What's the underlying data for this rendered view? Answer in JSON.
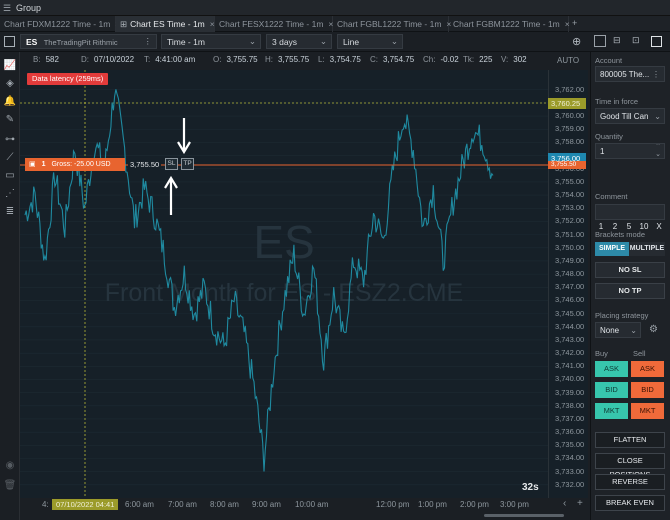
{
  "window": {
    "title": "Group"
  },
  "tabs": [
    {
      "label": "Chart FDXM1222 Time - 1m",
      "active": false
    },
    {
      "label": "Chart ES Time - 1m",
      "active": true
    },
    {
      "label": "Chart FESX1222 Time - 1m",
      "active": false
    },
    {
      "label": "Chart FGBL1222 Time - 1m",
      "active": false
    },
    {
      "label": "Chart FGBM1222 Time - 1m",
      "active": false
    }
  ],
  "toolbar": {
    "symbol": "ES",
    "account_source": "TheTradingPit Rithmic",
    "timeframe": "Time - 1m",
    "range": "3 days",
    "chart_style": "Line"
  },
  "infobar": {
    "B_label": "B:",
    "B": "582",
    "D_label": "D:",
    "D": "07/10/2022",
    "T_label": "T:",
    "T": "4:41:00 am",
    "O_label": "O:",
    "O": "3,755.75",
    "H_label": "H:",
    "H": "3,755.75",
    "L_label": "L:",
    "L": "3,754.75",
    "C_label": "C:",
    "C": "3,754.75",
    "Ch_label": "Ch:",
    "Ch": "-0.02",
    "Tk_label": "Tk:",
    "Tk": "225",
    "V_label": "V:",
    "V": "302"
  },
  "chart": {
    "latency_badge": "Data latency (259ms)",
    "watermark_symbol": "ES",
    "watermark_desc": "Front Month for ES - ESZ2.CME",
    "position_qty": "1",
    "position_text": "Gross: -25.00 USD",
    "position_price": "3,755.50",
    "sl_label": "SL",
    "tp_label": "TP",
    "timer": "32s",
    "crosshair_time": "07/10/2022 04:41",
    "auto_label": "AUTO",
    "price_flag_yellow": "3,760.25",
    "price_flag_blue": "3,756.00",
    "price_flag_blue2": "3,755.50",
    "colors": {
      "line": "#1f8aa0",
      "order": "#e8642f",
      "crosshair": "#b6b83a",
      "bg": "#162028"
    }
  },
  "chart_data": {
    "type": "line",
    "title": "",
    "xlabel": "",
    "ylabel": "",
    "ylim": [
      3731.0,
      3763.5
    ],
    "ticks_y": [
      "3,762.00",
      "3,761.00",
      "3,760.00",
      "3,759.00",
      "3,758.00",
      "3,757.00",
      "3,756.00",
      "3,755.00",
      "3,754.00",
      "3,753.00",
      "3,752.00",
      "3,751.00",
      "3,750.00",
      "3,749.00",
      "3,748.00",
      "3,747.00",
      "3,746.00",
      "3,745.00",
      "3,744.00",
      "3,743.00",
      "3,742.00",
      "3,741.00",
      "3,740.00",
      "3,739.00",
      "3,738.00",
      "3,737.00",
      "3,736.00",
      "3,735.00",
      "3,734.00",
      "3,733.00",
      "3,732.00"
    ],
    "ticks_x": [
      "4:",
      "6:00 am",
      "7:00 am",
      "8:00 am",
      "9:00 am",
      "10:00 am",
      "12:00 pm",
      "1:00 pm",
      "2:00 pm",
      "3:00 pm"
    ],
    "series": [
      {
        "x": [
          0,
          10,
          20,
          30,
          40,
          50,
          60,
          70,
          80,
          90,
          100,
          110,
          120,
          130,
          140,
          150,
          160,
          170,
          180,
          190,
          200,
          210,
          220,
          230,
          240,
          250,
          260,
          270,
          280,
          290,
          300,
          310,
          320,
          330,
          340,
          350,
          360,
          370,
          380,
          390,
          400,
          410,
          420,
          430,
          440,
          450,
          460,
          470
        ],
        "values": [
          3752.5,
          3754.0,
          3749.0,
          3755.5,
          3751.5,
          3757.5,
          3753.0,
          3758.0,
          3756.0,
          3762.0,
          3757.5,
          3752.0,
          3754.5,
          3752.5,
          3749.5,
          3745.5,
          3748.0,
          3745.0,
          3747.0,
          3744.0,
          3742.5,
          3746.0,
          3743.5,
          3739.5,
          3734.0,
          3741.0,
          3746.0,
          3749.5,
          3745.0,
          3748.5,
          3741.5,
          3746.5,
          3743.0,
          3749.0,
          3747.5,
          3752.5,
          3750.5,
          3756.0,
          3760.0,
          3757.5,
          3751.5,
          3754.5,
          3749.0,
          3753.5,
          3756.5,
          3759.0,
          3758.0,
          3755.5
        ]
      }
    ]
  },
  "right_panel": {
    "account_label": "Account",
    "account_value": "800005 The...",
    "tif_label": "Time in force",
    "tif_value": "Good Till Can",
    "qty_label": "Quantity",
    "qty_value": "1",
    "qty_presets": [
      "1",
      "2",
      "5",
      "10",
      "X"
    ],
    "comment_label": "Comment",
    "brackets_label": "Brackets mode",
    "simple_label": "SIMPLE",
    "multiple_label": "MULTIPLE",
    "no_sl": "NO SL",
    "no_tp": "NO TP",
    "placing_label": "Placing strategy",
    "placing_value": "None",
    "buy_label": "Buy",
    "sell_label": "Sell",
    "buy_ask": "ASK",
    "sell_ask": "ASK",
    "buy_bid": "BID",
    "sell_bid": "BID",
    "buy_mkt": "MKT",
    "sell_mkt": "MKT",
    "flatten": "FLATTEN",
    "close_positions": "CLOSE POSITIONS",
    "reverse": "REVERSE",
    "break_even": "BREAK EVEN"
  }
}
